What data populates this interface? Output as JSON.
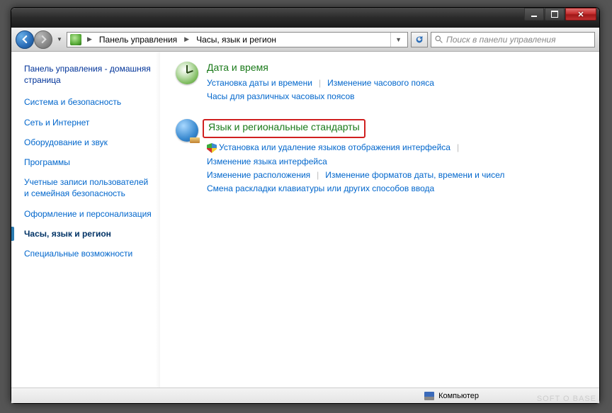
{
  "breadcrumb": {
    "root": "Панель управления",
    "current": "Часы, язык и регион"
  },
  "search": {
    "placeholder": "Поиск в панели управления"
  },
  "sidebar": {
    "home": "Панель управления - домашняя страница",
    "items": [
      {
        "label": "Система и безопасность"
      },
      {
        "label": "Сеть и Интернет"
      },
      {
        "label": "Оборудование и звук"
      },
      {
        "label": "Программы"
      },
      {
        "label": "Учетные записи пользователей и семейная безопасность"
      },
      {
        "label": "Оформление и персонализация"
      },
      {
        "label": "Часы, язык и регион",
        "active": true
      },
      {
        "label": "Специальные возможности"
      }
    ]
  },
  "sections": [
    {
      "title": "Дата и время",
      "links": [
        "Установка даты и времени",
        "Изменение часового пояса",
        "Часы для различных часовых поясов"
      ]
    },
    {
      "title": "Язык и региональные стандарты",
      "highlighted": true,
      "links": [
        "Установка или удаление языков отображения интерфейса",
        "Изменение языка интерфейса",
        "Изменение расположения",
        "Изменение форматов даты, времени и чисел",
        "Смена раскладки клавиатуры или других способов ввода"
      ]
    }
  ],
  "status": {
    "computer": "Компьютер"
  },
  "watermark": "SOFT O BASE"
}
